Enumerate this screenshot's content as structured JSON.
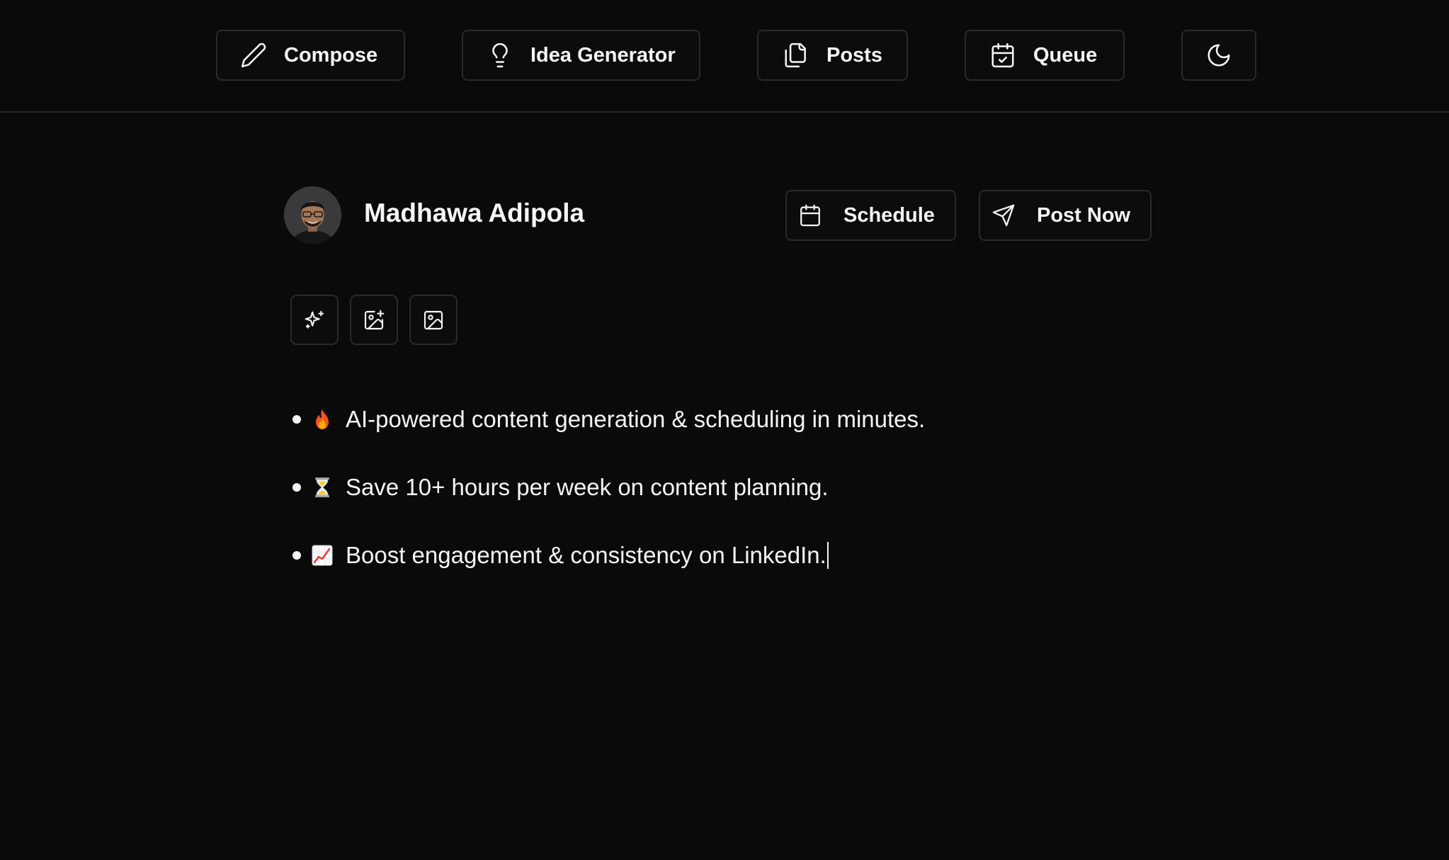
{
  "nav": {
    "compose_label": "Compose",
    "idea_generator_label": "Idea Generator",
    "posts_label": "Posts",
    "queue_label": "Queue"
  },
  "author": {
    "name": "Madhawa Adipola"
  },
  "actions": {
    "schedule_label": "Schedule",
    "post_now_label": "Post Now"
  },
  "toolbar": {
    "tools": [
      "sparkles-icon",
      "image-add-icon",
      "image-icon"
    ]
  },
  "editor": {
    "bullets": [
      {
        "emoji": "fire",
        "text": "AI-powered content generation & scheduling in minutes."
      },
      {
        "emoji": "hourglass",
        "text": "Save 10+ hours per week on content planning."
      },
      {
        "emoji": "chart-increasing",
        "text": "Boost engagement & consistency on LinkedIn."
      }
    ]
  },
  "colors": {
    "background": "#0a0a0a",
    "border": "#2a2a2a",
    "text": "#f5f5f5"
  }
}
